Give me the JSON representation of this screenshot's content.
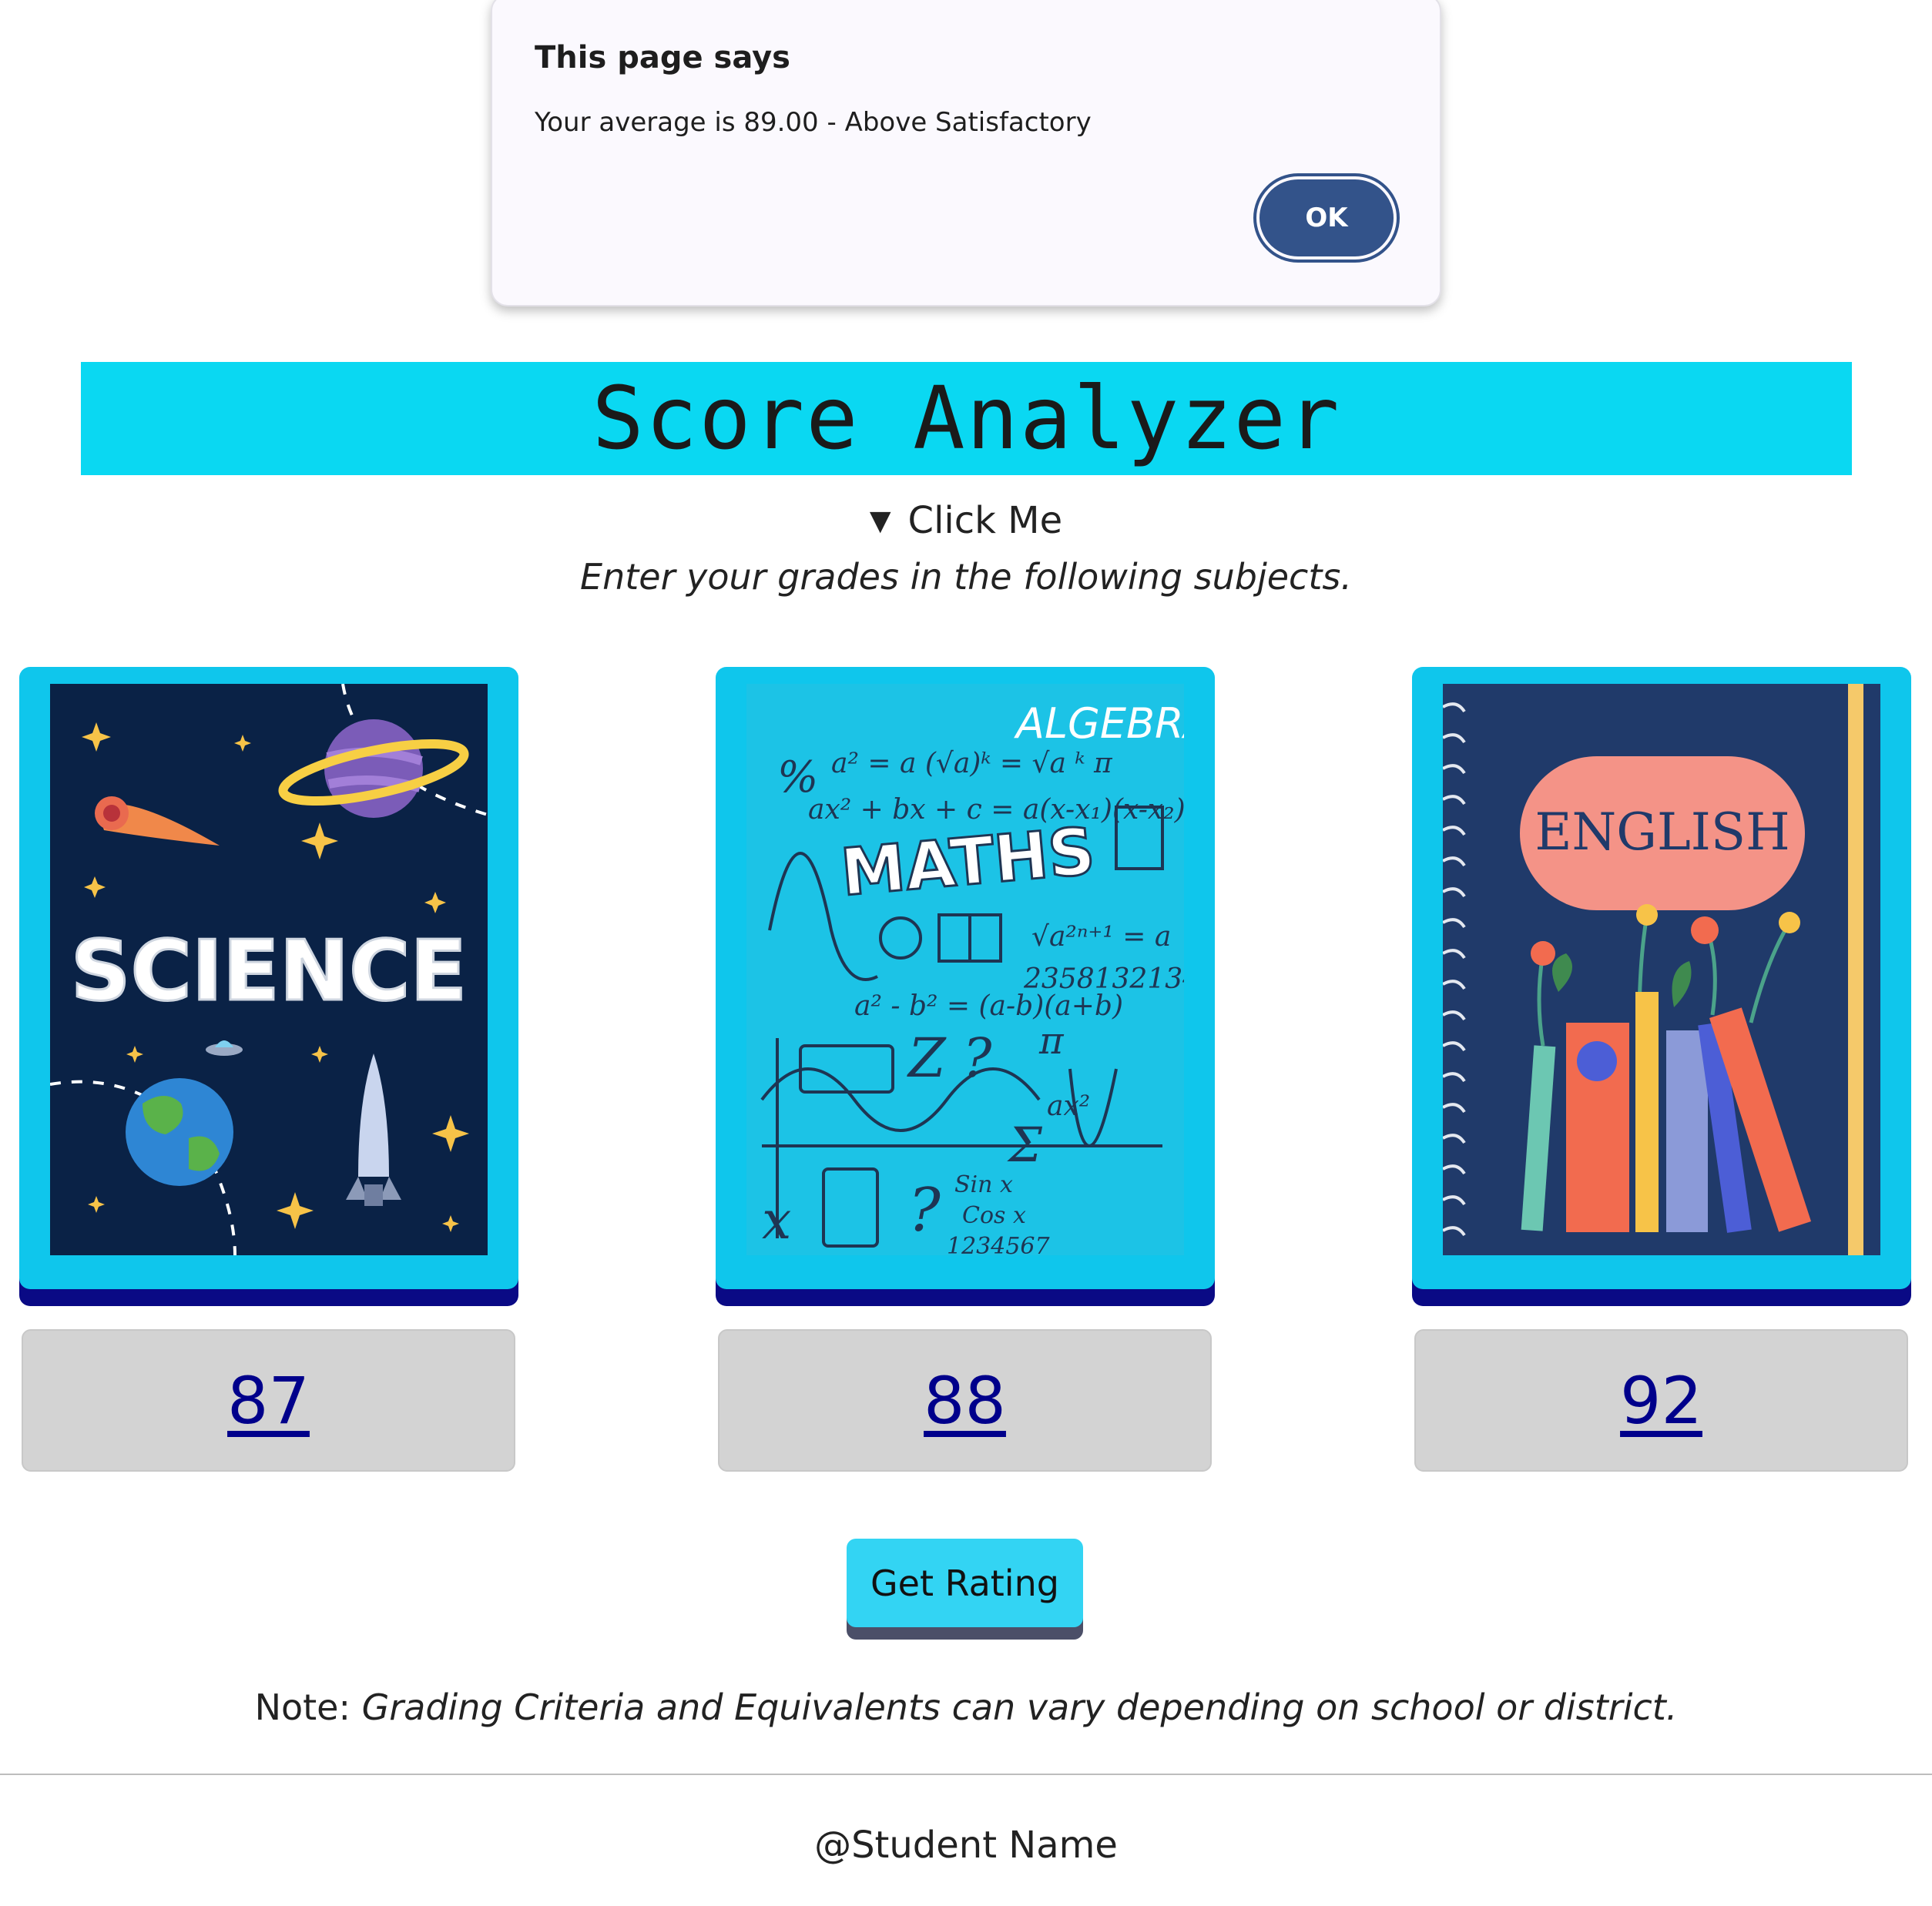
{
  "dialog": {
    "title": "This page says",
    "message": "Your average is 89.00 - Above Satisfactory",
    "ok_label": "OK"
  },
  "header": {
    "title": "Score Analyzer"
  },
  "details": {
    "summary": "Click Me",
    "indicator_icon": "triangle-down-icon"
  },
  "instructions": "Enter your grades in the following subjects.",
  "subjects": [
    {
      "cover_text": "SCIENCE",
      "grade": "87",
      "cover_color": "#0a2246"
    },
    {
      "cover_text": "MATHS",
      "cover_subtext": "ALGEBRA",
      "grade": "88",
      "cover_color": "#1cc3e6"
    },
    {
      "cover_text": "ENGLISH",
      "grade": "92",
      "cover_color": "#203a6a"
    }
  ],
  "rating_button": {
    "label": "Get Rating"
  },
  "note": {
    "prefix": "Note: ",
    "text": "Grading Criteria and Equivalents can vary depending on school or district."
  },
  "footer": {
    "text": "@Student Name"
  },
  "colors": {
    "header_bg": "#0ad8f2",
    "card_bg": "#0fc6ec",
    "card_shadow": "#0a0a85",
    "grade_text": "#00008b",
    "ok_button": "#33538a"
  }
}
